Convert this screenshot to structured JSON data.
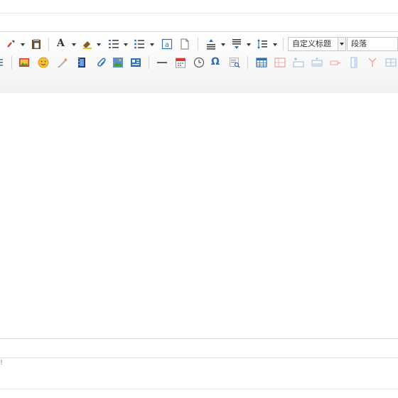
{
  "toolbar": {
    "row1": {
      "font_color_letter": "A",
      "heading_select": {
        "value": "自定义标题"
      },
      "paragraph_select": {
        "value": "段落"
      }
    },
    "row2": {
      "omega_symbol": "Ω"
    },
    "colors": {
      "accent_blue": "#2f6fb6",
      "red": "#d9392b",
      "orange": "#f0a020",
      "green": "#4a9a3a"
    }
  },
  "statusbar": {
    "text": "!"
  }
}
